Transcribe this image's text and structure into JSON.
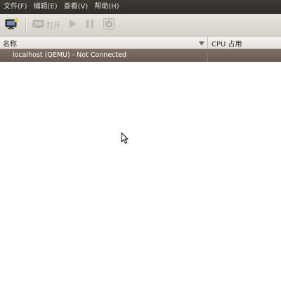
{
  "menu": {
    "items": [
      {
        "label": "文件(F)"
      },
      {
        "label": "编辑(E)"
      },
      {
        "label": "查看(V)"
      },
      {
        "label": "帮助(H)"
      }
    ]
  },
  "toolbar": {
    "new_vm_icon": "monitor-new-icon",
    "open_icon": "monitor-open-icon",
    "open_label": "打开",
    "run_icon": "play-icon",
    "pause_icon": "pause-icon",
    "shutdown_icon": "power-icon"
  },
  "columns": {
    "name": "名称",
    "cpu": "CPU 占用"
  },
  "rows": [
    {
      "name": "localhost (QEMU) - Not Connected",
      "selected": true
    }
  ],
  "colors": {
    "menubar": "#3c3b37",
    "selection": "#76675d",
    "toolbar": "#dfdbd4"
  }
}
